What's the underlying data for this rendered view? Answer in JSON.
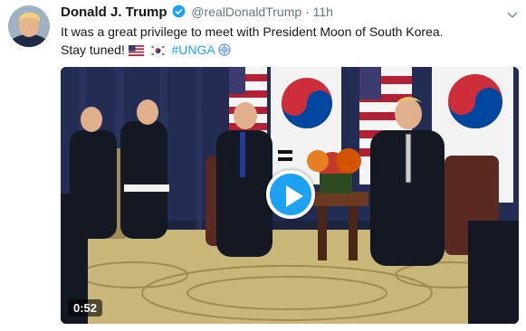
{
  "tweet": {
    "author_name": "Donald J. Trump",
    "handle": "@realDonaldTrump",
    "separator": "·",
    "timestamp": "11h",
    "text_line1": "It was a great privilege to meet with President Moon of South Korea.",
    "text_line2_prefix": "Stay tuned!",
    "hashtag": "#UNGA",
    "emojis": [
      "us-flag",
      "south-korea-flag",
      "globe-emblem"
    ]
  },
  "video": {
    "duration": "0:52"
  },
  "colors": {
    "accent": "#1da1f2",
    "text_primary": "#14171a",
    "text_secondary": "#657786"
  }
}
